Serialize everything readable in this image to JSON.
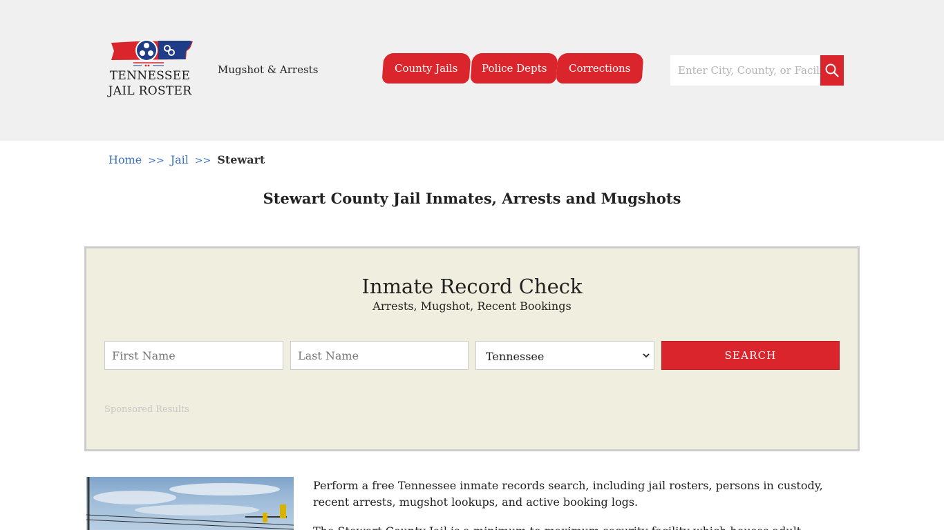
{
  "header": {
    "logo_line1": "TENNESSEE",
    "logo_line2": "JAIL ROSTER",
    "tagline": "Mugshot & Arrests",
    "nav": [
      "County Jails",
      "Police Depts",
      "Corrections"
    ],
    "search_placeholder": "Enter City, County, or Facility",
    "icons": {
      "search": "search-icon",
      "logo": "tennessee-flag-logo"
    }
  },
  "breadcrumb": {
    "home": "Home",
    "separator": ">>",
    "jail": "Jail",
    "current": "Stewart"
  },
  "page_title": "Stewart County Jail Inmates, Arrests and Mugshots",
  "record_check": {
    "title": "Inmate Record Check",
    "subtitle": "Arrests, Mugshot, Recent Bookings",
    "first_name_placeholder": "First Name",
    "last_name_placeholder": "Last Name",
    "state_selected": "Tennessee",
    "search_label": "SEARCH",
    "sponsored": "Sponsored Results"
  },
  "content": {
    "intro": "Perform a free Tennessee inmate records search, including jail rosters, persons in custody, recent arrests, mugshot lookups, and active booking logs.",
    "intro2": "The Stewart County Jail is a minimum to maximum security facility which houses adult inmates and"
  },
  "colors": {
    "accent": "#d9252b",
    "header_bg": "#f0f0f0",
    "box_bg": "#f0eedf",
    "link": "#3a6fc4"
  }
}
